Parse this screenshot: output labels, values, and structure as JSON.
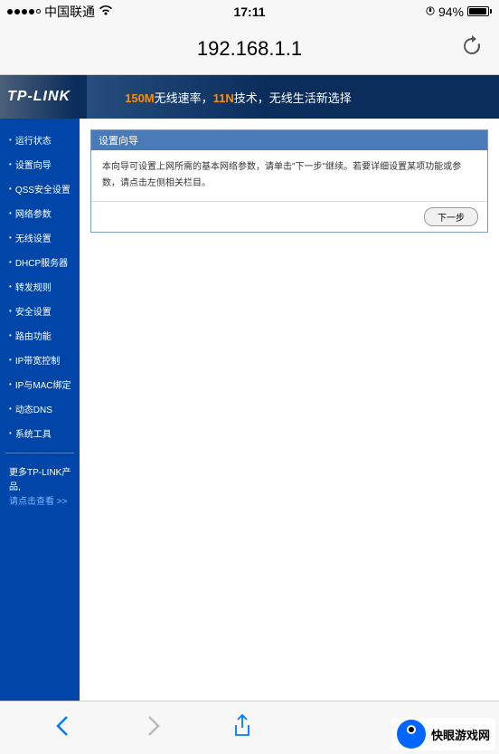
{
  "status_bar": {
    "carrier": "中国联通",
    "time": "17:11",
    "battery_pct": "94%"
  },
  "browser": {
    "url": "192.168.1.1"
  },
  "banner": {
    "logo": "TP-LINK",
    "text_part1": "150M",
    "text_part2": "无线速率，",
    "text_part3": "11N",
    "text_part4": "技术，无线生活新选择"
  },
  "sidebar": {
    "items": [
      "运行状态",
      "设置向导",
      "QSS安全设置",
      "网络参数",
      "无线设置",
      "DHCP服务器",
      "转发规则",
      "安全设置",
      "路由功能",
      "IP带宽控制",
      "IP与MAC绑定",
      "动态DNS",
      "系统工具"
    ],
    "footer_line1": "更多TP-LINK产品,",
    "footer_line2": "请点击查看 >>"
  },
  "wizard": {
    "header": "设置向导",
    "body": "本向导可设置上网所需的基本网络参数，请单击\"下一步\"继续。若要详细设置某项功能或参数，请点击左侧相关栏目。",
    "next_button": "下一步"
  },
  "watermark": {
    "text": "快眼游戏网"
  }
}
